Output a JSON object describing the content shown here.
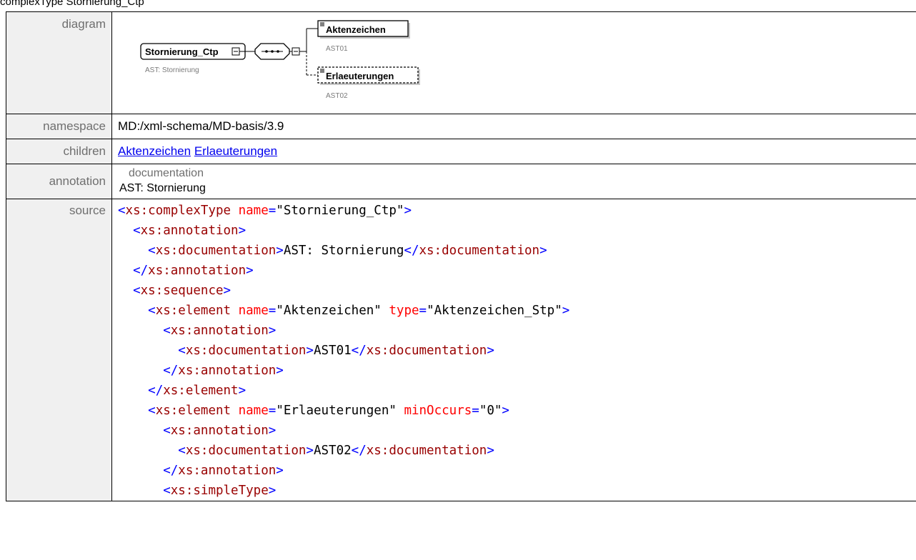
{
  "heading": "complexType Stornierung_Ctp",
  "labels": {
    "diagram": "diagram",
    "namespace": "namespace",
    "children": "children",
    "annotation": "annotation",
    "source": "source"
  },
  "diagram": {
    "root_name": "Stornierung_Ctp",
    "root_doc": "AST: Stornierung",
    "child1_name": "Aktenzeichen",
    "child1_doc": "AST01",
    "child2_name": "Erlaeuterungen",
    "child2_doc": "AST02"
  },
  "namespace": "MD:/xml-schema/MD-basis/3.9",
  "children": [
    {
      "label": "Aktenzeichen"
    },
    {
      "label": "Erlaeuterungen"
    }
  ],
  "annotation": {
    "documentation_label": "documentation",
    "text": "AST: Stornierung"
  },
  "source_lines": [
    [
      [
        "tag",
        "<"
      ],
      [
        "nm",
        "xs:complexType"
      ],
      [
        "tx",
        " "
      ],
      [
        "attr",
        "name"
      ],
      [
        "tag",
        "="
      ],
      [
        "av",
        "\"Stornierung_Ctp\""
      ],
      [
        "tag",
        ">"
      ]
    ],
    [
      [
        "tx",
        "  "
      ],
      [
        "tag",
        "<"
      ],
      [
        "nm",
        "xs:annotation"
      ],
      [
        "tag",
        ">"
      ]
    ],
    [
      [
        "tx",
        "    "
      ],
      [
        "tag",
        "<"
      ],
      [
        "nm",
        "xs:documentation"
      ],
      [
        "tag",
        ">"
      ],
      [
        "tx",
        "AST: Stornierung"
      ],
      [
        "tag",
        "</"
      ],
      [
        "nm",
        "xs:documentation"
      ],
      [
        "tag",
        ">"
      ]
    ],
    [
      [
        "tx",
        "  "
      ],
      [
        "tag",
        "</"
      ],
      [
        "nm",
        "xs:annotation"
      ],
      [
        "tag",
        ">"
      ]
    ],
    [
      [
        "tx",
        "  "
      ],
      [
        "tag",
        "<"
      ],
      [
        "nm",
        "xs:sequence"
      ],
      [
        "tag",
        ">"
      ]
    ],
    [
      [
        "tx",
        "    "
      ],
      [
        "tag",
        "<"
      ],
      [
        "nm",
        "xs:element"
      ],
      [
        "tx",
        " "
      ],
      [
        "attr",
        "name"
      ],
      [
        "tag",
        "="
      ],
      [
        "av",
        "\"Aktenzeichen\""
      ],
      [
        "tx",
        " "
      ],
      [
        "attr",
        "type"
      ],
      [
        "tag",
        "="
      ],
      [
        "av",
        "\"Aktenzeichen_Stp\""
      ],
      [
        "tag",
        ">"
      ]
    ],
    [
      [
        "tx",
        "      "
      ],
      [
        "tag",
        "<"
      ],
      [
        "nm",
        "xs:annotation"
      ],
      [
        "tag",
        ">"
      ]
    ],
    [
      [
        "tx",
        "        "
      ],
      [
        "tag",
        "<"
      ],
      [
        "nm",
        "xs:documentation"
      ],
      [
        "tag",
        ">"
      ],
      [
        "tx",
        "AST01"
      ],
      [
        "tag",
        "</"
      ],
      [
        "nm",
        "xs:documentation"
      ],
      [
        "tag",
        ">"
      ]
    ],
    [
      [
        "tx",
        "      "
      ],
      [
        "tag",
        "</"
      ],
      [
        "nm",
        "xs:annotation"
      ],
      [
        "tag",
        ">"
      ]
    ],
    [
      [
        "tx",
        "    "
      ],
      [
        "tag",
        "</"
      ],
      [
        "nm",
        "xs:element"
      ],
      [
        "tag",
        ">"
      ]
    ],
    [
      [
        "tx",
        "    "
      ],
      [
        "tag",
        "<"
      ],
      [
        "nm",
        "xs:element"
      ],
      [
        "tx",
        " "
      ],
      [
        "attr",
        "name"
      ],
      [
        "tag",
        "="
      ],
      [
        "av",
        "\"Erlaeuterungen\""
      ],
      [
        "tx",
        " "
      ],
      [
        "attr",
        "minOccurs"
      ],
      [
        "tag",
        "="
      ],
      [
        "av",
        "\"0\""
      ],
      [
        "tag",
        ">"
      ]
    ],
    [
      [
        "tx",
        "      "
      ],
      [
        "tag",
        "<"
      ],
      [
        "nm",
        "xs:annotation"
      ],
      [
        "tag",
        ">"
      ]
    ],
    [
      [
        "tx",
        "        "
      ],
      [
        "tag",
        "<"
      ],
      [
        "nm",
        "xs:documentation"
      ],
      [
        "tag",
        ">"
      ],
      [
        "tx",
        "AST02"
      ],
      [
        "tag",
        "</"
      ],
      [
        "nm",
        "xs:documentation"
      ],
      [
        "tag",
        ">"
      ]
    ],
    [
      [
        "tx",
        "      "
      ],
      [
        "tag",
        "</"
      ],
      [
        "nm",
        "xs:annotation"
      ],
      [
        "tag",
        ">"
      ]
    ],
    [
      [
        "tx",
        "      "
      ],
      [
        "tag",
        "<"
      ],
      [
        "nm",
        "xs:simpleType"
      ],
      [
        "tag",
        ">"
      ]
    ]
  ]
}
